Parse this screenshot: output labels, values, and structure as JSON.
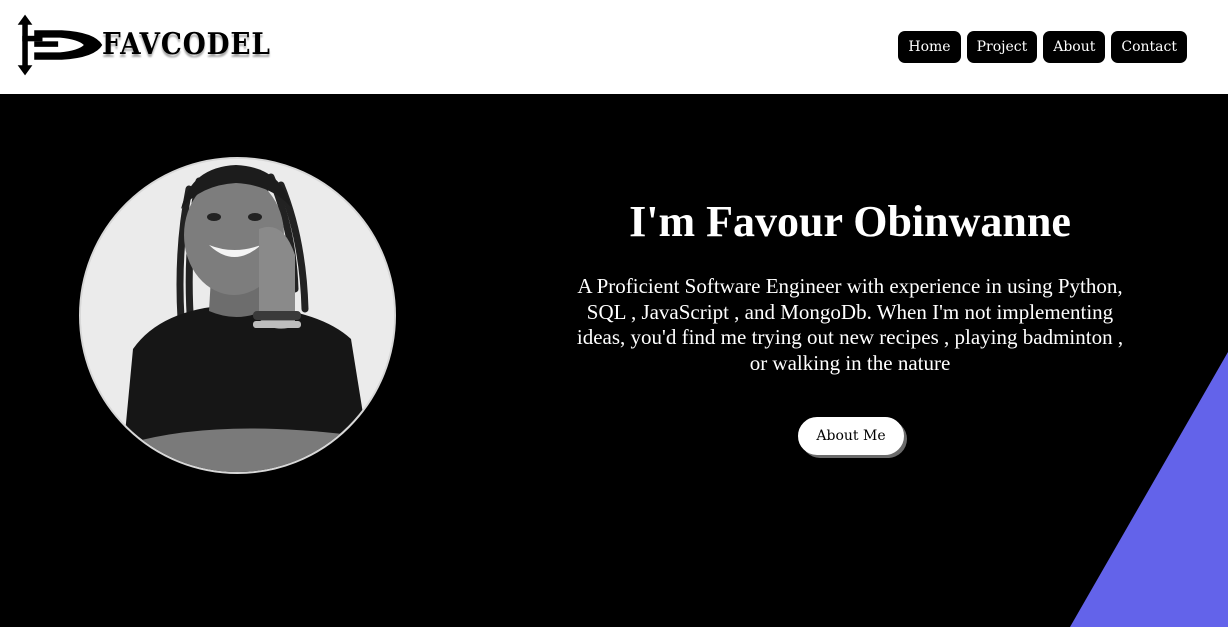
{
  "brand": {
    "name": "FAVCODEL",
    "logo_icon": "arrow-f-logo"
  },
  "nav": {
    "items": [
      {
        "label": "Home"
      },
      {
        "label": "Project"
      },
      {
        "label": "About"
      },
      {
        "label": "Contact"
      }
    ]
  },
  "hero": {
    "headline": "I'm Favour Obinwanne",
    "bio": "A Proficient Software Engineer with experience in using Python, SQL , JavaScript , and MongoDb. When I'm not implementing ideas, you'd find me trying out new recipes , playing badminton , or walking in the nature",
    "cta_label": "About Me",
    "portrait_alt": "black-and-white portrait photo"
  },
  "colors": {
    "header_bg": "#ffffff",
    "hero_bg": "#000000",
    "accent": "#6363ea",
    "nav_bg": "#000000"
  }
}
